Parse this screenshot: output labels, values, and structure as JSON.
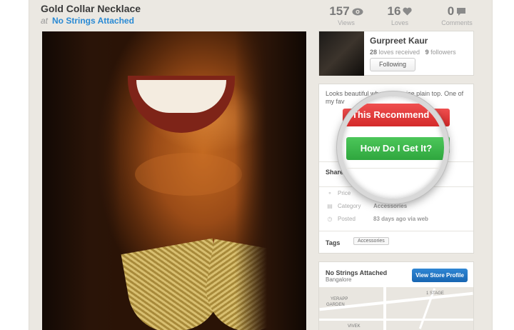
{
  "product": {
    "title": "Gold Collar Necklace",
    "at_label": "at",
    "store_name": "No Strings Attached"
  },
  "stats": {
    "views": {
      "count": "157",
      "label": "Views"
    },
    "loves": {
      "count": "16",
      "label": "Loves"
    },
    "comments": {
      "count": "0",
      "label": "Comments"
    }
  },
  "user": {
    "name": "Gurpreet Kaur",
    "loves_count": "28",
    "loves_label": "loves received",
    "followers_count": "9",
    "followers_label": "followers",
    "follow_button": "Following"
  },
  "details": {
    "description": "Looks beautiful whe           with a nice plain top. One of my fav",
    "recommend_button": "This Recommend",
    "get_button": "How Do I Get It?",
    "share_label": "Share",
    "meta": [
      {
        "icon": "tag-icon",
        "key": "Price",
        "value": ""
      },
      {
        "icon": "folder-icon",
        "key": "Category",
        "value": "Accessories"
      },
      {
        "icon": "clock-icon",
        "key": "Posted",
        "value": "83 days ago via web"
      }
    ],
    "tags_label": "Tags",
    "tags": [
      "Accessories"
    ]
  },
  "store": {
    "name": "No Strings Attached",
    "city": "Bangalore",
    "button": "View Store Profile",
    "map_labels": [
      "1 STAGE",
      "YERAPP",
      "GARDEN",
      "VIVEK"
    ]
  },
  "colors": {
    "accent_blue": "#2a8ad4",
    "red_button": "#d42a2a",
    "green_button": "#2fa63e",
    "page_bg": "#ebe8e2"
  }
}
